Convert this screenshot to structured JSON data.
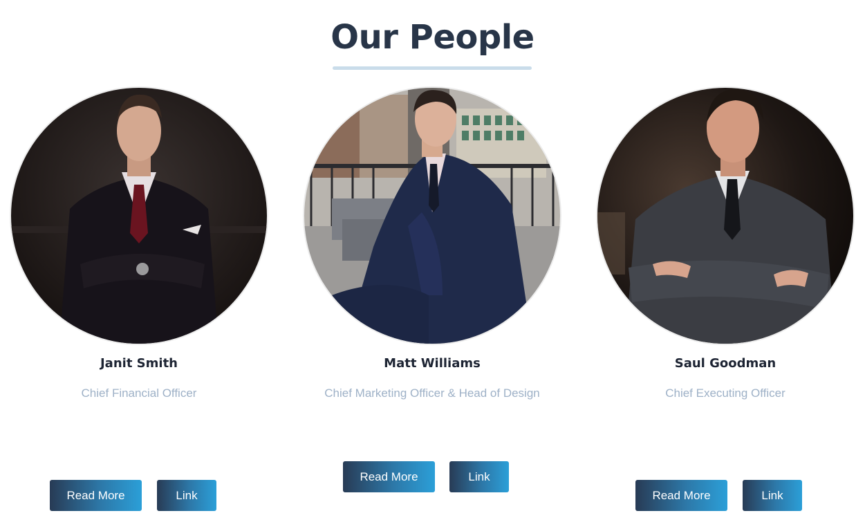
{
  "section": {
    "title": "Our People"
  },
  "people": [
    {
      "name": "Janit Smith",
      "role": "Chief Financial Officer",
      "read_more_label": "Read More",
      "link_label": "Link"
    },
    {
      "name": "Matt Williams",
      "role": "Chief Marketing Officer & Head of Design",
      "read_more_label": "Read More",
      "link_label": "Link"
    },
    {
      "name": "Saul Goodman",
      "role": "Chief Executing Officer",
      "read_more_label": "Read More",
      "link_label": "Link"
    }
  ],
  "colors": {
    "title": "#283548",
    "underline": "#c9dcea",
    "name": "#1d2433",
    "role": "#9eb1c7",
    "button_start": "#283b55",
    "button_end": "#2b9fd8"
  }
}
